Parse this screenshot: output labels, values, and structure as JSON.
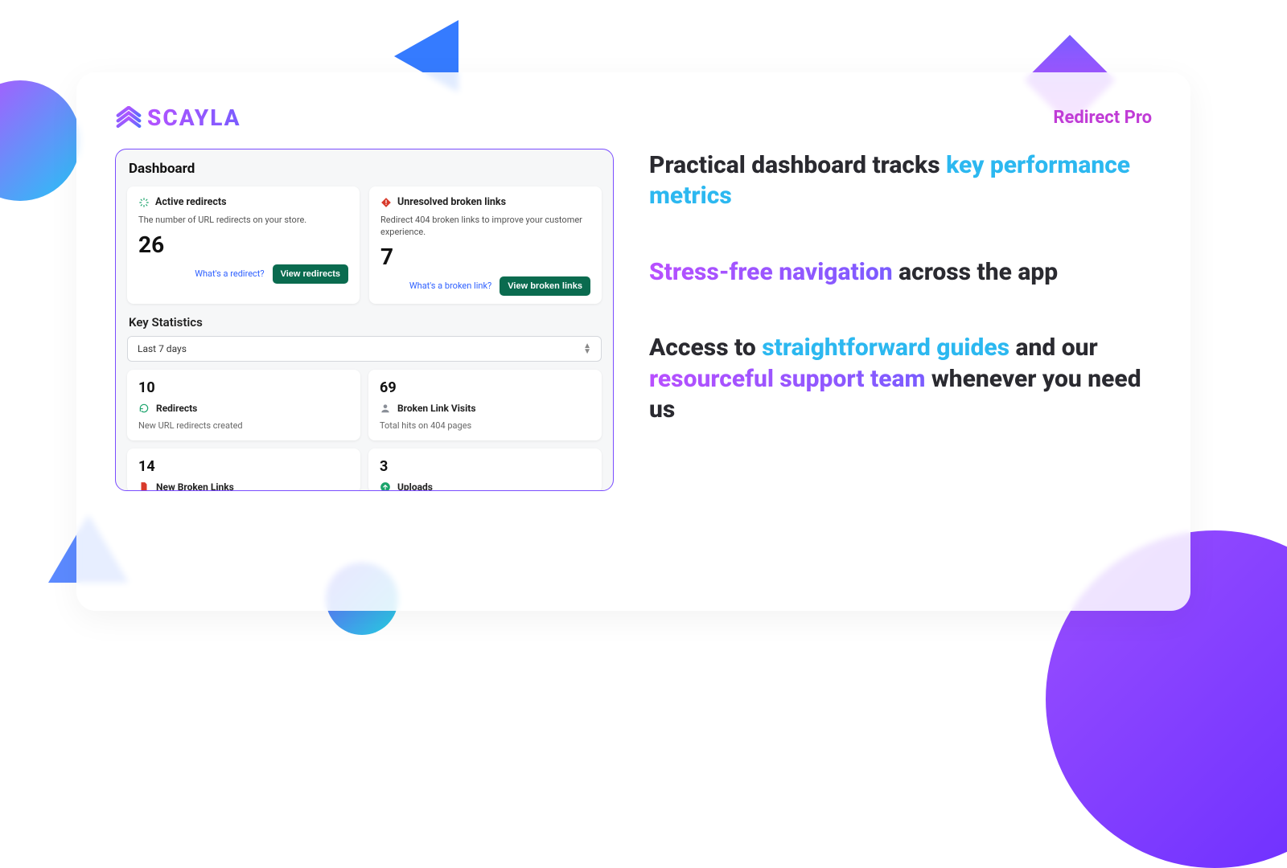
{
  "brand": "SCAYLA",
  "product": "Redirect Pro",
  "dashboard": {
    "title": "Dashboard",
    "cards": {
      "redirects": {
        "title": "Active redirects",
        "desc": "The number of URL redirects on your store.",
        "value": "26",
        "help_link": "What's a redirect?",
        "button": "View redirects"
      },
      "broken": {
        "title": "Unresolved broken links",
        "desc": "Redirect 404 broken links to improve your customer experience.",
        "value": "7",
        "help_link": "What's a broken link?",
        "button": "View broken links"
      }
    },
    "stats": {
      "section_title": "Key Statistics",
      "range": "Last 7 days",
      "items": {
        "a": {
          "value": "10",
          "label": "Redirects",
          "sub": "New URL redirects created"
        },
        "b": {
          "value": "69",
          "label": "Broken Link Visits",
          "sub": "Total hits on 404 pages"
        },
        "c": {
          "value": "14",
          "label": "New Broken Links"
        },
        "d": {
          "value": "3",
          "label": "Uploads"
        }
      }
    }
  },
  "copy": {
    "l1a": "Practical dashboard tracks ",
    "l1b": "key performance metrics",
    "l2a": "Stress-free navigation",
    "l2b": " across the app",
    "l3a": "Access to ",
    "l3b": "straightforward guides",
    "l3c": " and our ",
    "l3d": "resourceful support team",
    "l3e": " whenever you need us"
  }
}
